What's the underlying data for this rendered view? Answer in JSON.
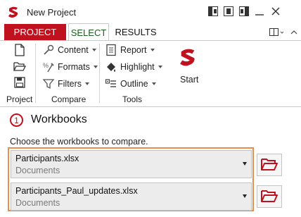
{
  "window": {
    "title": "New Project",
    "buttons": [
      "layout-left-icon",
      "layout-center-icon",
      "layout-right-icon",
      "minimize-icon",
      "close-icon"
    ]
  },
  "tabs": [
    {
      "label": "PROJECT",
      "active": false
    },
    {
      "label": "SELECT",
      "active": true
    },
    {
      "label": "RESULTS",
      "active": false
    }
  ],
  "ribbon": {
    "groups": {
      "project": "Project",
      "compare": "Compare",
      "tools": "Tools"
    },
    "compare_items": {
      "content": "Content",
      "formats": "Formats",
      "filters": "Filters"
    },
    "tools_items": {
      "report": "Report",
      "highlight": "Highlight",
      "outline": "Outline"
    },
    "start_label": "Start"
  },
  "section": {
    "step": "1",
    "title": "Workbooks",
    "description": "Choose the workbooks to compare."
  },
  "workbooks": [
    {
      "name": "Participants.xlsx",
      "location": "Documents"
    },
    {
      "name": "Participants_Paul_updates.xlsx",
      "location": "Documents"
    }
  ],
  "colors": {
    "brand": "#c0111f",
    "active_tab_text": "#1b5e20",
    "highlight_frame": "#e88d4b"
  }
}
